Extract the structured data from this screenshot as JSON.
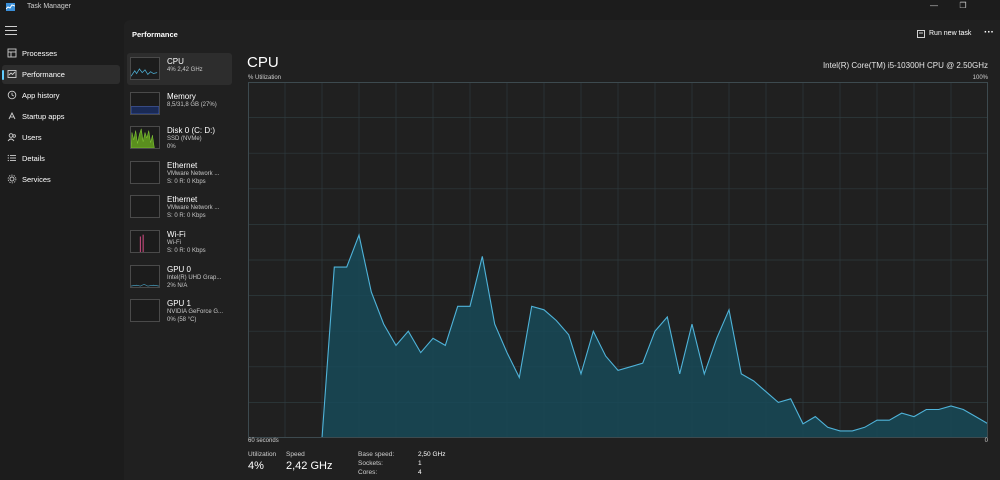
{
  "window": {
    "title": "Task Manager",
    "minimize": "—",
    "restore": "❐"
  },
  "nav": {
    "items": [
      {
        "label": "Processes",
        "icon": "processes-icon"
      },
      {
        "label": "Performance",
        "icon": "performance-icon",
        "active": true
      },
      {
        "label": "App history",
        "icon": "app-history-icon"
      },
      {
        "label": "Startup apps",
        "icon": "startup-apps-icon"
      },
      {
        "label": "Users",
        "icon": "users-icon"
      },
      {
        "label": "Details",
        "icon": "details-icon"
      },
      {
        "label": "Services",
        "icon": "services-icon"
      }
    ]
  },
  "header": {
    "title": "Performance",
    "run_new_task": "Run new task",
    "more": "···"
  },
  "devices": [
    {
      "name": "CPU",
      "line2": "4% 2,42 GHz",
      "line3": "",
      "active": true,
      "graph_color": "#4fb3d9"
    },
    {
      "name": "Memory",
      "line2": "8,5/31,8 GB (27%)",
      "line3": "",
      "graph_color": "#4f6fd9"
    },
    {
      "name": "Disk 0 (C: D:)",
      "line2": "SSD (NVMe)",
      "line3": "0%",
      "graph_color": "#8cd93c"
    },
    {
      "name": "Ethernet",
      "line2": "VMware Network ...",
      "line3": "S: 0 R: 0 Kbps",
      "graph_color": "#c8508c"
    },
    {
      "name": "Ethernet",
      "line2": "VMware Network ...",
      "line3": "S: 0 R: 0 Kbps",
      "graph_color": "#c8508c"
    },
    {
      "name": "Wi-Fi",
      "line2": "Wi-Fi",
      "line3": "S: 0 R: 0 Kbps",
      "graph_color": "#e0508c"
    },
    {
      "name": "GPU 0",
      "line2": "Intel(R) UHD Grap...",
      "line3": "2% N/A",
      "graph_color": "#4fb3d9"
    },
    {
      "name": "GPU 1",
      "line2": "NVIDIA GeForce G...",
      "line3": "0% (58 °C)",
      "graph_color": "#4fb3d9"
    }
  ],
  "detail": {
    "title": "CPU",
    "model": "Intel(R) Core(TM) i5-10300H CPU @ 2.50GHz",
    "util_label": "% Utilization",
    "util_max": "100%",
    "axis_left": "60 seconds",
    "axis_right": "0",
    "utilization_label": "Utilization",
    "utilization_value": "4%",
    "speed_label": "Speed",
    "speed_value": "2,42 GHz",
    "specs": [
      {
        "key": "Base speed:",
        "value": "2,50 GHz"
      },
      {
        "key": "Sockets:",
        "value": "1"
      },
      {
        "key": "Cores:",
        "value": "4"
      }
    ]
  },
  "colors": {
    "graph_line": "#4fb3d9",
    "graph_fill": "#174a58",
    "grid": "#2e3a3e",
    "accent": "#60cdff"
  },
  "chart_data": {
    "type": "area",
    "xlabel": "60 seconds",
    "ylabel": "% Utilization",
    "ylim": [
      0,
      100
    ],
    "xlim": [
      0,
      60
    ],
    "x": [
      0,
      6,
      7,
      8,
      9,
      10,
      11,
      12,
      13,
      14,
      15,
      16,
      17,
      18,
      19,
      20,
      21,
      22,
      23,
      24,
      25,
      26,
      27,
      28,
      29,
      30,
      31,
      32,
      33,
      34,
      35,
      36,
      37,
      38,
      39,
      40,
      41,
      42,
      43,
      44,
      45,
      46,
      47,
      48,
      49,
      50,
      51,
      52,
      53,
      54,
      55,
      56,
      57,
      58,
      59,
      60
    ],
    "values": [
      0,
      0,
      48,
      48,
      57,
      41,
      32,
      26,
      30,
      24,
      28,
      26,
      37,
      37,
      51,
      32,
      24,
      17,
      37,
      36,
      33,
      29,
      18,
      30,
      23,
      19,
      20,
      21,
      30,
      34,
      18,
      32,
      18,
      28,
      36,
      18,
      16,
      13,
      10,
      11,
      4,
      6,
      3,
      2,
      2,
      3,
      5,
      5,
      7,
      6,
      8,
      8,
      9,
      8,
      6,
      4
    ]
  }
}
